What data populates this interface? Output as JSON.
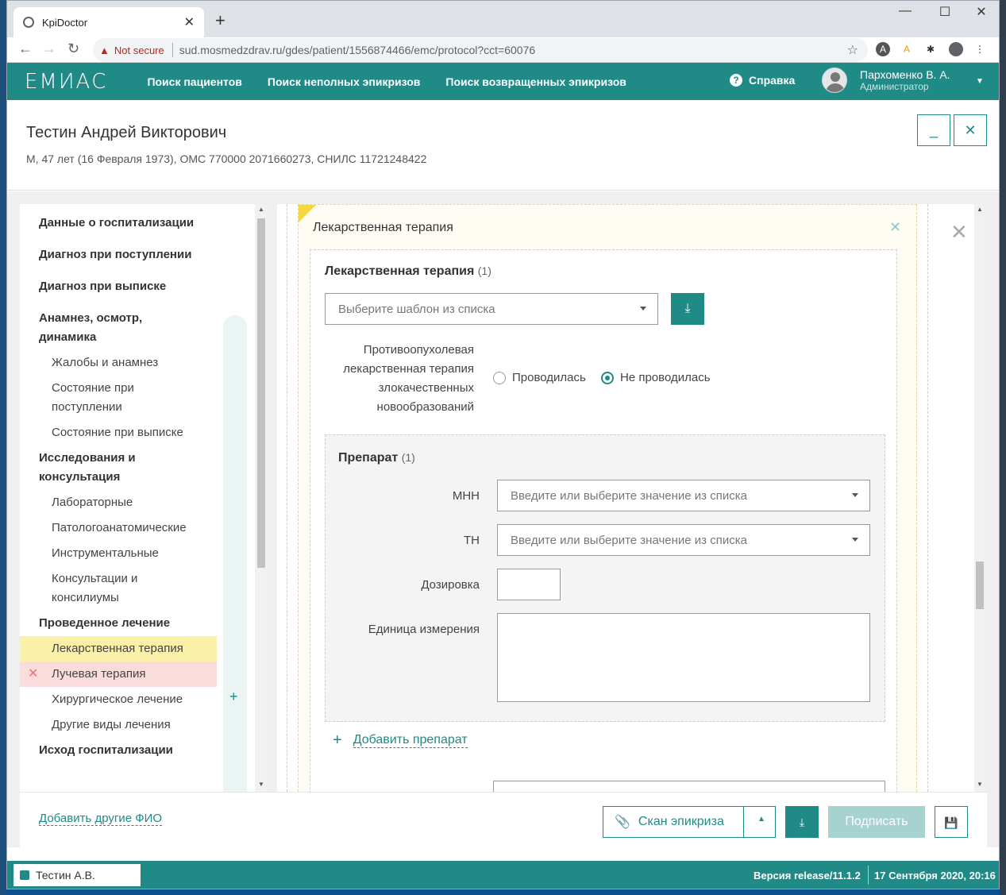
{
  "browser": {
    "tab_title": "KpiDoctor",
    "close_tab": "✕",
    "new_tab": "+",
    "not_secure": "Not secure",
    "url": "sud.mosmedzdrav.ru/gdes/patient/1556874466/emc/protocol?cct=60076"
  },
  "header": {
    "logo": "ЕМИАС",
    "nav": [
      "Поиск пациентов",
      "Поиск неполных эпикризов",
      "Поиск возвращенных эпикризов"
    ],
    "help": "Справка",
    "user_name": "Пархоменко В. А.",
    "user_role": "Администратор"
  },
  "patient": {
    "name": "Тестин Андрей Викторович",
    "info": "М, 47 лет (16 Февраля 1973), ОМС 770000 2071660273, СНИЛС 11721248422"
  },
  "sidebar": {
    "items": [
      {
        "label": "Данные о госпитализации",
        "level": 1
      },
      {
        "label": "Диагноз при поступлении",
        "level": 1
      },
      {
        "label": "Диагноз при выписке",
        "level": 1
      },
      {
        "label": "Анамнез, осмотр, динамика",
        "level": 1
      },
      {
        "label": "Жалобы и анамнез",
        "level": 2
      },
      {
        "label": "Состояние при поступлении",
        "level": 2
      },
      {
        "label": "Состояние при выписке",
        "level": 2
      },
      {
        "label": "Исследования и консультация",
        "level": 1
      },
      {
        "label": "Лабораторные",
        "level": 2
      },
      {
        "label": "Патологоанатомические",
        "level": 2
      },
      {
        "label": "Инструментальные",
        "level": 2
      },
      {
        "label": "Консультации и консилиумы",
        "level": 2
      },
      {
        "label": "Проведенное лечение",
        "level": 1
      },
      {
        "label": "Лекарственная терапия",
        "level": 2
      },
      {
        "label": "Лучевая терапия",
        "level": 2
      },
      {
        "label": "Хирургическое лечение",
        "level": 2
      },
      {
        "label": "Другие виды лечения",
        "level": 2
      },
      {
        "label": "Исход госпитализации",
        "level": 1
      }
    ]
  },
  "form": {
    "section_title": "Лекарственная терапия",
    "inner_title": "Лекарственная терапия",
    "inner_count": "(1)",
    "template_placeholder": "Выберите шаблон из списка",
    "antitumor_label": "Противоопухолевая лекарственная терапия злокачественных новообразований",
    "radio_yes": "Проводилась",
    "radio_no": "Не проводилась",
    "radio_selected": "Не проводилась",
    "drug_title": "Препарат",
    "drug_count": "(1)",
    "mnn_label": "МНН",
    "mnn_placeholder": "Введите или выберите значение из списка",
    "tn_label": "ТН",
    "tn_placeholder": "Введите или выберите значение из списка",
    "dose_label": "Дозировка",
    "unit_label": "Единица измерения",
    "add_drug": "Добавить препарат"
  },
  "bottom": {
    "add_fio": "Добавить другие ФИО",
    "scan": "Скан эпикриза",
    "sign": "Подписать"
  },
  "status": {
    "user_chip": "Тестин А.В.",
    "version": "Версия release/11.1.2",
    "datetime": "17 Сентября 2020, 20:16"
  },
  "colors": {
    "accent": "#1f8a86",
    "active_item": "#fbf0a8",
    "error_item": "#fbdcdc"
  }
}
